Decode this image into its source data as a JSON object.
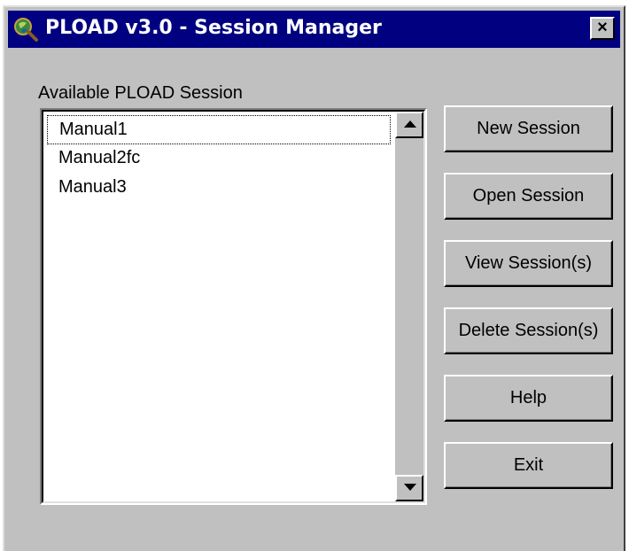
{
  "window": {
    "title": "PLOAD v3.0 - Session Manager",
    "close_glyph": "×",
    "app_icon": "magnifier-globe-icon"
  },
  "session_list": {
    "label": "Available PLOAD Session",
    "items": [
      "Manual1",
      "Manual2fc",
      "Manual3"
    ],
    "selected": "Manual1"
  },
  "buttons": {
    "new_session": "New Session",
    "open_session": "Open Session",
    "view_sessions": "View Session(s)",
    "delete_sessions": "Delete Session(s)",
    "help": "Help",
    "exit": "Exit"
  },
  "colors": {
    "title_bar": "#000080",
    "face": "#c0c0c0",
    "list_background": "#ffffff"
  }
}
